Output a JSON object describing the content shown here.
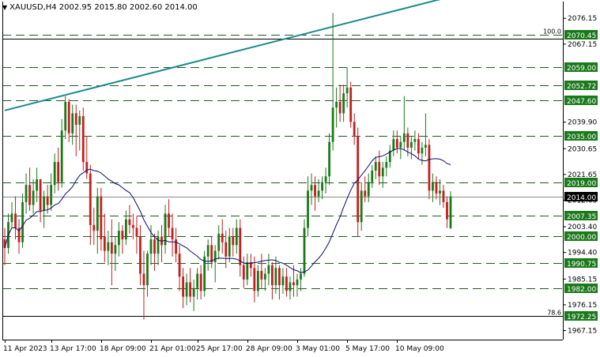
{
  "header": {
    "symbol": "XAUUSD,H4",
    "ohlc": "2002.95 2015.80 2002.60 2014.00"
  },
  "colors": {
    "bull": "#1a7a1a",
    "bear": "#c41e1e",
    "level_line": "#1e5a1e",
    "label_bg": "#1a7a1a",
    "current_label_bg": "#000000",
    "trendline": "#1f8a8a",
    "ma": "#0a0a6e",
    "axis": "#000000"
  },
  "chart_data": {
    "type": "candlestick",
    "symbol": "XAUUSD",
    "timeframe": "H4",
    "y_ticks": [
      "2076.15",
      "2067.15",
      "2039.90",
      "2030.65",
      "2021.65",
      "2012.65",
      "2003.40",
      "1994.40",
      "1985.15",
      "1976.15",
      "1967.15"
    ],
    "x_ticks": [
      "11 Apr 2023",
      "13 Apr 17:00",
      "18 Apr 09:00",
      "21 Apr 01:00",
      "25 Apr 17:00",
      "28 Apr 09:00",
      "3 May 01:00",
      "5 May 17:00",
      "10 May 09:00"
    ],
    "ylim": [
      1964,
      2082
    ],
    "levels": [
      {
        "price": 2070.45,
        "label": "2070.45",
        "tag": "100.0"
      },
      {
        "price": 2059.0,
        "label": "2059.00",
        "tag": ""
      },
      {
        "price": 2052.72,
        "label": "2052.72",
        "tag": ""
      },
      {
        "price": 2047.6,
        "label": "2047.60",
        "tag": ""
      },
      {
        "price": 2035.0,
        "label": "2035.00",
        "tag": ""
      },
      {
        "price": 2019.0,
        "label": "2019.00",
        "tag": ""
      },
      {
        "price": 2007.35,
        "label": "2007.35",
        "tag": ""
      },
      {
        "price": 2000.0,
        "label": "2000.00",
        "tag": ""
      },
      {
        "price": 1990.75,
        "label": "1990.75",
        "tag": ""
      },
      {
        "price": 1982.0,
        "label": "1982.00",
        "tag": ""
      },
      {
        "price": 1972.25,
        "label": "1972.25",
        "tag": "78.6"
      }
    ],
    "current_price": {
      "price": 2014.0,
      "label": "2014.00"
    },
    "trendline": {
      "from_bar": 0,
      "from_price": 2044,
      "to_bar": 129,
      "to_price": 2085
    },
    "candles": [
      [
        1999,
        2003,
        1990,
        1996
      ],
      [
        1996,
        2008,
        1994,
        2005
      ],
      [
        2005,
        2012,
        2003,
        2008
      ],
      [
        2008,
        2014,
        1999,
        2003
      ],
      [
        2003,
        2006,
        1994,
        1998
      ],
      [
        1998,
        2015,
        1996,
        2012
      ],
      [
        2012,
        2022,
        2008,
        2018
      ],
      [
        2018,
        2024,
        2009,
        2011
      ],
      [
        2011,
        2020,
        2008,
        2016
      ],
      [
        2016,
        2024,
        2012,
        2020
      ],
      [
        2020,
        2019,
        2005,
        2009
      ],
      [
        2009,
        2016,
        2003,
        2014
      ],
      [
        2014,
        2018,
        2008,
        2011
      ],
      [
        2011,
        2022,
        2009,
        2018
      ],
      [
        2018,
        2029,
        2015,
        2026
      ],
      [
        2026,
        2031,
        2016,
        2019
      ],
      [
        2019,
        2041,
        2017,
        2037
      ],
      [
        2037,
        2049,
        2034,
        2047
      ],
      [
        2047,
        2048,
        2033,
        2036
      ],
      [
        2036,
        2046,
        2032,
        2043
      ],
      [
        2043,
        2046,
        2028,
        2039
      ],
      [
        2039,
        2044,
        2030,
        2042
      ],
      [
        2042,
        2045,
        2023,
        2026
      ],
      [
        2026,
        2035,
        2020,
        2022
      ],
      [
        2022,
        2025,
        1997,
        2004
      ],
      [
        2004,
        2010,
        1997,
        2002
      ],
      [
        2002,
        2017,
        1994,
        2014
      ],
      [
        2014,
        2017,
        1995,
        1999
      ],
      [
        2000,
        2008,
        1991,
        1995
      ],
      [
        1995,
        2002,
        1990,
        1998
      ],
      [
        1998,
        2006,
        1983,
        1994
      ],
      [
        1994,
        2000,
        1988,
        1997
      ],
      [
        1997,
        2005,
        1993,
        2002
      ],
      [
        2002,
        2004,
        1994,
        1999
      ],
      [
        1999,
        2009,
        1997,
        2006
      ],
      [
        2006,
        2011,
        2001,
        2004
      ],
      [
        2004,
        2008,
        1999,
        2003
      ],
      [
        2003,
        2007,
        1994,
        2000
      ],
      [
        2000,
        2004,
        1983,
        1987
      ],
      [
        1987,
        1995,
        1971,
        1983
      ],
      [
        1983,
        1995,
        1979,
        1994
      ],
      [
        1994,
        2004,
        1990,
        1999
      ],
      [
        1999,
        2001,
        1988,
        1994
      ],
      [
        1994,
        2002,
        1990,
        2000
      ],
      [
        2000,
        2004,
        1991,
        1997
      ],
      [
        1997,
        2011,
        1994,
        2008
      ],
      [
        2008,
        2013,
        2000,
        2003
      ],
      [
        2003,
        2008,
        1993,
        1999
      ],
      [
        1999,
        2003,
        1991,
        1994
      ],
      [
        1994,
        1997,
        1981,
        1986
      ],
      [
        1986,
        1989,
        1975,
        1979
      ],
      [
        1979,
        1987,
        1976,
        1984
      ],
      [
        1984,
        1989,
        1977,
        1979
      ],
      [
        1979,
        1985,
        1974,
        1982
      ],
      [
        1982,
        1989,
        1978,
        1987
      ],
      [
        1987,
        1990,
        1978,
        1981
      ],
      [
        1981,
        1995,
        1979,
        1993
      ],
      [
        1993,
        1999,
        1988,
        1997
      ],
      [
        1997,
        2000,
        1989,
        1991
      ],
      [
        1991,
        1997,
        1984,
        1995
      ],
      [
        1995,
        2004,
        1992,
        2001
      ],
      [
        2001,
        2006,
        1994,
        1998
      ],
      [
        1998,
        2002,
        1989,
        1993
      ],
      [
        1993,
        2003,
        1991,
        2000
      ],
      [
        2000,
        2003,
        1993,
        1997
      ],
      [
        1997,
        2006,
        1994,
        2003
      ],
      [
        2003,
        2006,
        1986,
        1990
      ],
      [
        1990,
        1993,
        1982,
        1985
      ],
      [
        1985,
        1994,
        1983,
        1991
      ],
      [
        1991,
        1994,
        1986,
        1989
      ],
      [
        1989,
        1993,
        1977,
        1981
      ],
      [
        1981,
        1990,
        1979,
        1988
      ],
      [
        1988,
        1994,
        1982,
        1985
      ],
      [
        1985,
        1989,
        1981,
        1987
      ],
      [
        1987,
        1994,
        1983,
        1990
      ],
      [
        1990,
        1991,
        1978,
        1983
      ],
      [
        1983,
        1993,
        1980,
        1989
      ],
      [
        1989,
        1990,
        1978,
        1983
      ],
      [
        1983,
        1989,
        1980,
        1986
      ],
      [
        1986,
        1989,
        1979,
        1981
      ],
      [
        1981,
        1986,
        1978,
        1984
      ],
      [
        1984,
        1990,
        1979,
        1983
      ],
      [
        1983,
        1987,
        1979,
        1985
      ],
      [
        1985,
        1989,
        1981,
        1987
      ],
      [
        1987,
        2006,
        1986,
        2003
      ],
      [
        2003,
        2021,
        2000,
        2016
      ],
      [
        2016,
        2022,
        2011,
        2018
      ],
      [
        2018,
        2021,
        2009,
        2014
      ],
      [
        2014,
        2020,
        2012,
        2016
      ],
      [
        2016,
        2021,
        2013,
        2019
      ],
      [
        2019,
        2024,
        2015,
        2021
      ],
      [
        2021,
        2036,
        2018,
        2033
      ],
      [
        2033,
        2078,
        2030,
        2045
      ],
      [
        2045,
        2052,
        2038,
        2047
      ],
      [
        2047,
        2053,
        2040,
        2043
      ],
      [
        2043,
        2053,
        2040,
        2050
      ],
      [
        2050,
        2059,
        2045,
        2052
      ],
      [
        2052,
        2054,
        2038,
        2040
      ],
      [
        2040,
        2043,
        2032,
        2035
      ],
      [
        2035,
        2038,
        2000,
        2005
      ],
      [
        2005,
        2019,
        2002,
        2016
      ],
      [
        2016,
        2021,
        2012,
        2014
      ],
      [
        2014,
        2022,
        2012,
        2019
      ],
      [
        2019,
        2025,
        2017,
        2023
      ],
      [
        2023,
        2028,
        2020,
        2026
      ],
      [
        2026,
        2030,
        2018,
        2021
      ],
      [
        2021,
        2026,
        2017,
        2024
      ],
      [
        2024,
        2028,
        2021,
        2026
      ],
      [
        2026,
        2032,
        2024,
        2030
      ],
      [
        2030,
        2037,
        2028,
        2034
      ],
      [
        2034,
        2037,
        2029,
        2031
      ],
      [
        2031,
        2035,
        2027,
        2033
      ],
      [
        2033,
        2049,
        2030,
        2036
      ],
      [
        2036,
        2038,
        2028,
        2031
      ],
      [
        2031,
        2035,
        2027,
        2033
      ],
      [
        2033,
        2037,
        2030,
        2034
      ],
      [
        2034,
        2036,
        2027,
        2029
      ],
      [
        2029,
        2033,
        2025,
        2031
      ],
      [
        2031,
        2043,
        2028,
        2032
      ],
      [
        2032,
        2034,
        2013,
        2016
      ],
      [
        2016,
        2022,
        2012,
        2019
      ],
      [
        2019,
        2021,
        2013,
        2015
      ],
      [
        2015,
        2020,
        2011,
        2016
      ],
      [
        2016,
        2018,
        2010,
        2012
      ],
      [
        2012,
        2014,
        2003,
        2006
      ],
      [
        2002.95,
        2015.8,
        2002.6,
        2014.0
      ]
    ],
    "ma_period": 20
  }
}
